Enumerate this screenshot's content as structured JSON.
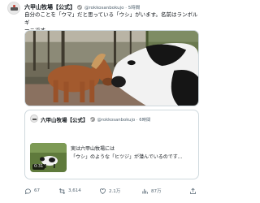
{
  "post": {
    "author_name": "六甲山牧場【公式】",
    "author_handle": "@rokkosanbokujo",
    "time_ago": "5時間",
    "text_line1": "自分のことを「ウマ」だと思っている「ウシ」がいます。名前はランボルギ",
    "text_line2": "ーニです。",
    "media_alt": "pony-and-holstein-cow-photo",
    "media_colors": {
      "pony": "#a35a2e",
      "cow_white": "#f2f2f2",
      "cow_black": "#151515",
      "ground": "#8a7160"
    }
  },
  "quote": {
    "author_name": "六甲山牧場【公式】",
    "author_handle": "@rokkosanbokujo",
    "time_ago": "6時間",
    "text_line1": "実は六甲山牧場には",
    "text_line2": "「ウシ」のような「ヒツジ」が潜んでいるのです...",
    "video_duration": "0:31"
  },
  "actions": {
    "reply_count": "67",
    "retweet_count": "3,614",
    "like_count": "2.1万",
    "views_count": "87万"
  },
  "icons": {
    "reply": "reply-icon",
    "retweet": "retweet-icon",
    "like": "heart-icon",
    "views": "views-chart-icon",
    "share": "share-icon",
    "verified": "verified-badge-icon"
  },
  "colors": {
    "muted_text": "#536471",
    "border": "#cfd9de",
    "verified_badge": "#9a9a9a"
  }
}
